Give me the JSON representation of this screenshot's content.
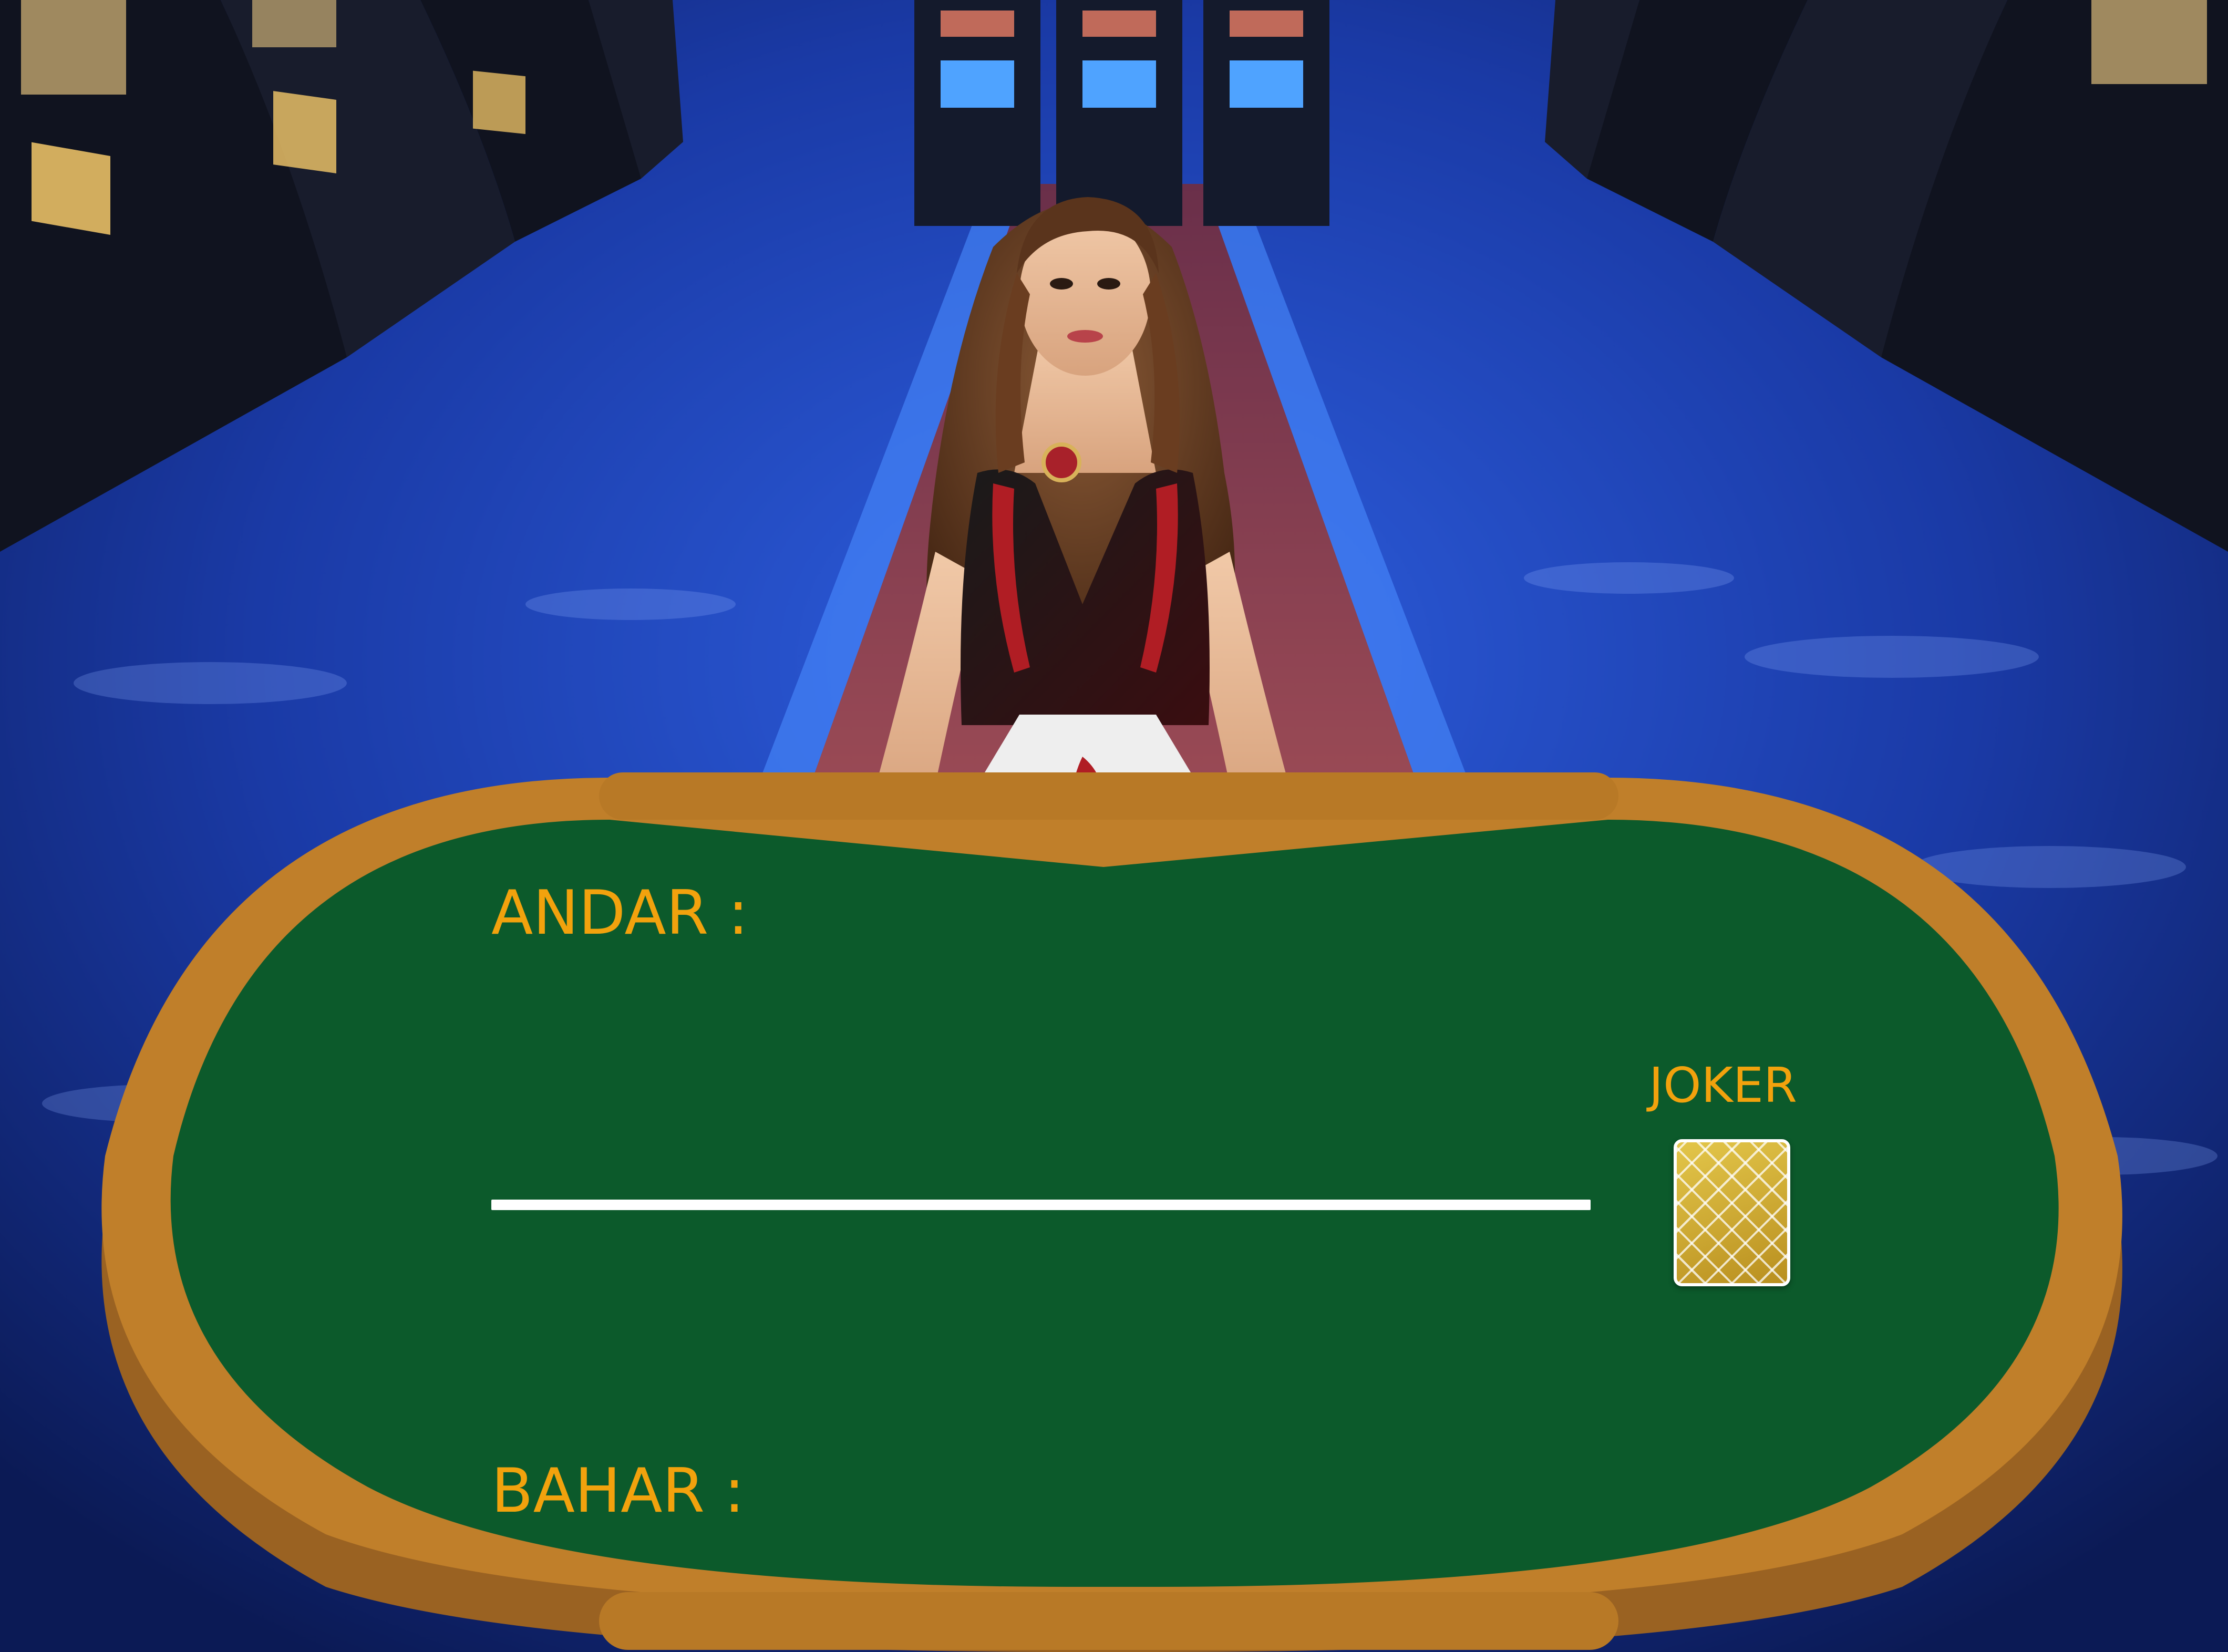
{
  "table": {
    "andar_label": "ANDAR :",
    "bahar_label": "BAHAR :",
    "joker_label": "JOKER"
  },
  "colors": {
    "felt": "#0c5a2b",
    "rim": "#c07f2a",
    "label_text": "#f2a20d",
    "divider": "#ffffff",
    "card_back": "#c6a52b"
  },
  "icons": {
    "joker_card": "card-back-icon",
    "dealer": "dealer-avatar"
  }
}
